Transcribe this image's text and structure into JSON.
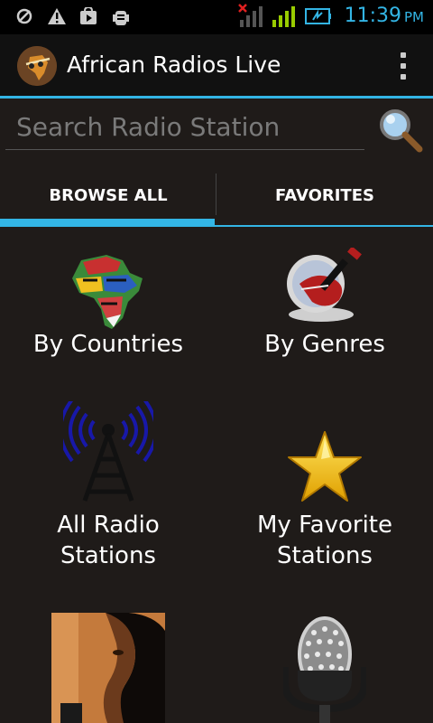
{
  "status_bar": {
    "time": "11:39",
    "ampm": "PM",
    "accent": "#33b5e5"
  },
  "app_bar": {
    "title": "African Radios Live",
    "logo_icon": "africa-radio-logo-icon",
    "menu_icon": "overflow-menu-icon"
  },
  "search": {
    "placeholder": "Search Radio Station",
    "value": "",
    "icon": "magnifier-icon"
  },
  "tabs": [
    {
      "label": "BROWSE ALL",
      "selected": true
    },
    {
      "label": "FAVORITES",
      "selected": false
    }
  ],
  "grid": [
    {
      "label": "By Countries",
      "icon": "africa-flags-map-icon"
    },
    {
      "label": "By Genres",
      "icon": "guitar-cd-icon"
    },
    {
      "label_line1": "All Radio",
      "label_line2": "Stations",
      "icon": "radio-tower-icon"
    },
    {
      "label_line1": "My Favorite",
      "label_line2": "Stations",
      "icon": "star-icon"
    },
    {
      "label": "",
      "icon": "singer-photo-icon"
    },
    {
      "label": "",
      "icon": "microphone-icon"
    }
  ]
}
